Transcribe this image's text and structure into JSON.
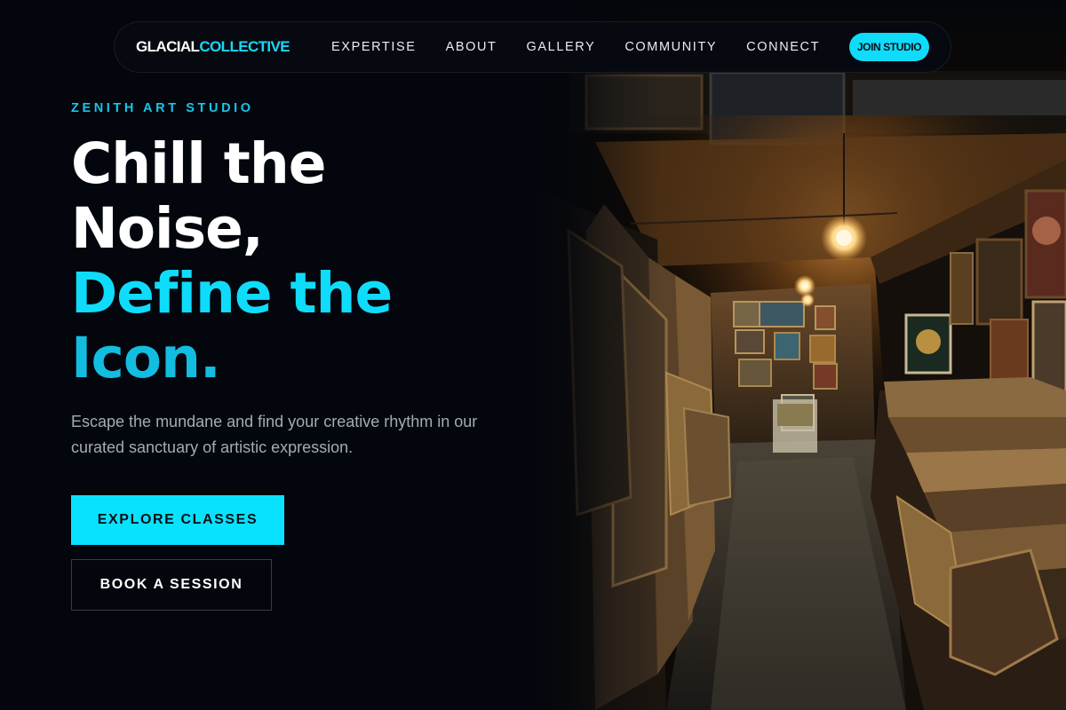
{
  "nav": {
    "logo_part1": "GLACIAL",
    "logo_part2": "COLLECTIVE",
    "links": [
      "EXPERTISE",
      "ABOUT",
      "GALLERY",
      "COMMUNITY",
      "CONNECT"
    ],
    "cta_label": "JOIN STUDIO"
  },
  "hero": {
    "eyebrow": "ZENITH ART STUDIO",
    "headline_line1": "Chill the",
    "headline_line2": "Noise,",
    "headline_line3": "Define the",
    "headline_line4": "Icon.",
    "subtext": "Escape the mundane and find your creative rhythm in our curated sanctuary of artistic expression.",
    "primary_button": "EXPLORE CLASSES",
    "secondary_button": "BOOK A SESSION"
  },
  "colors": {
    "background": "#03060c",
    "accent": "#0fdcfb",
    "muted_text": "#a3abb7"
  },
  "image": {
    "subject": "art-studio-corridor-photo"
  }
}
